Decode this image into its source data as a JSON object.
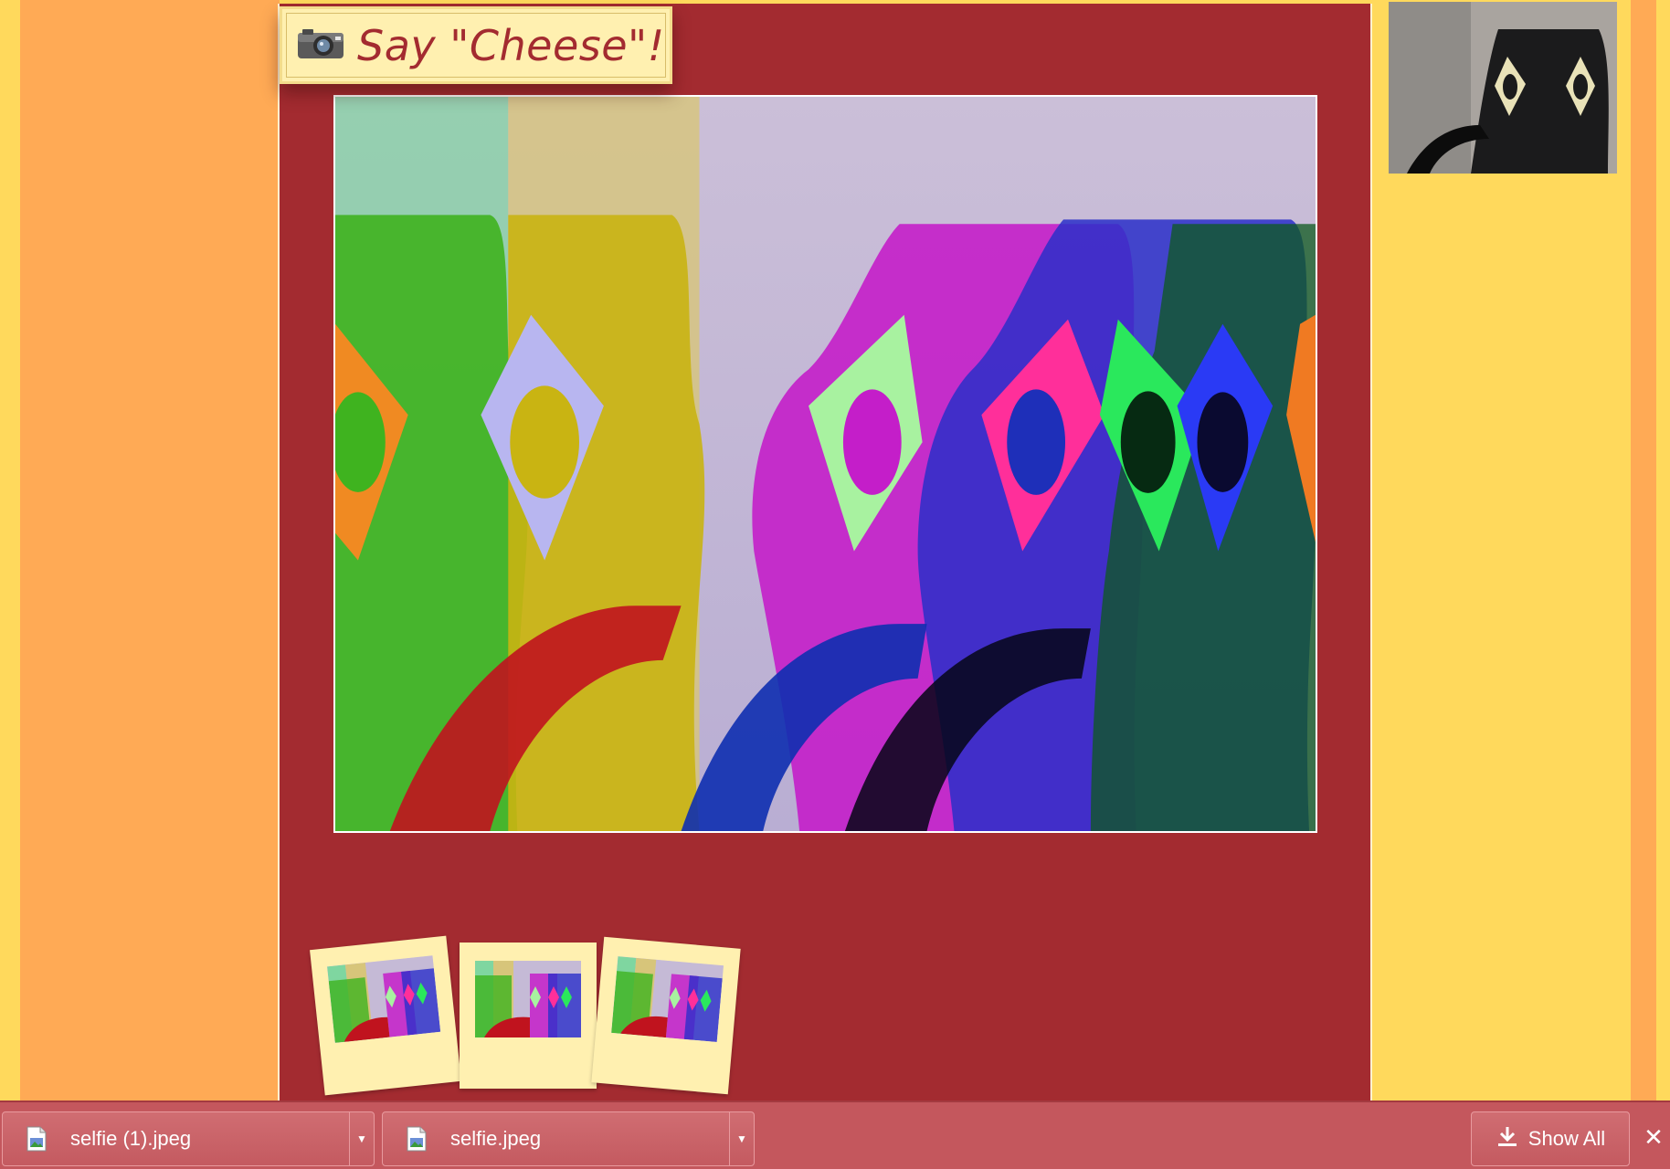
{
  "title": {
    "icon": "camera-icon",
    "text": "Say \"Cheese\"!"
  },
  "colors": {
    "background_yellow": "#ffd95c",
    "background_orange": "#ffaa55",
    "panel_red": "#a32b30",
    "banner_cream": "#fff0b0",
    "download_bar": "#c4575d"
  },
  "thumbnails": [
    {
      "name": "selfie-thumbnail-1"
    },
    {
      "name": "selfie-thumbnail-2"
    },
    {
      "name": "selfie-thumbnail-3"
    }
  ],
  "download_bar": {
    "items": [
      {
        "filename": "selfie (1).jpeg",
        "icon": "image-file-icon",
        "menu_icon": "chevron-down-icon"
      },
      {
        "filename": "selfie.jpeg",
        "icon": "image-file-icon",
        "menu_icon": "chevron-down-icon"
      }
    ],
    "show_all_label": "Show All",
    "show_all_icon": "download-icon",
    "close_icon": "close-icon"
  }
}
